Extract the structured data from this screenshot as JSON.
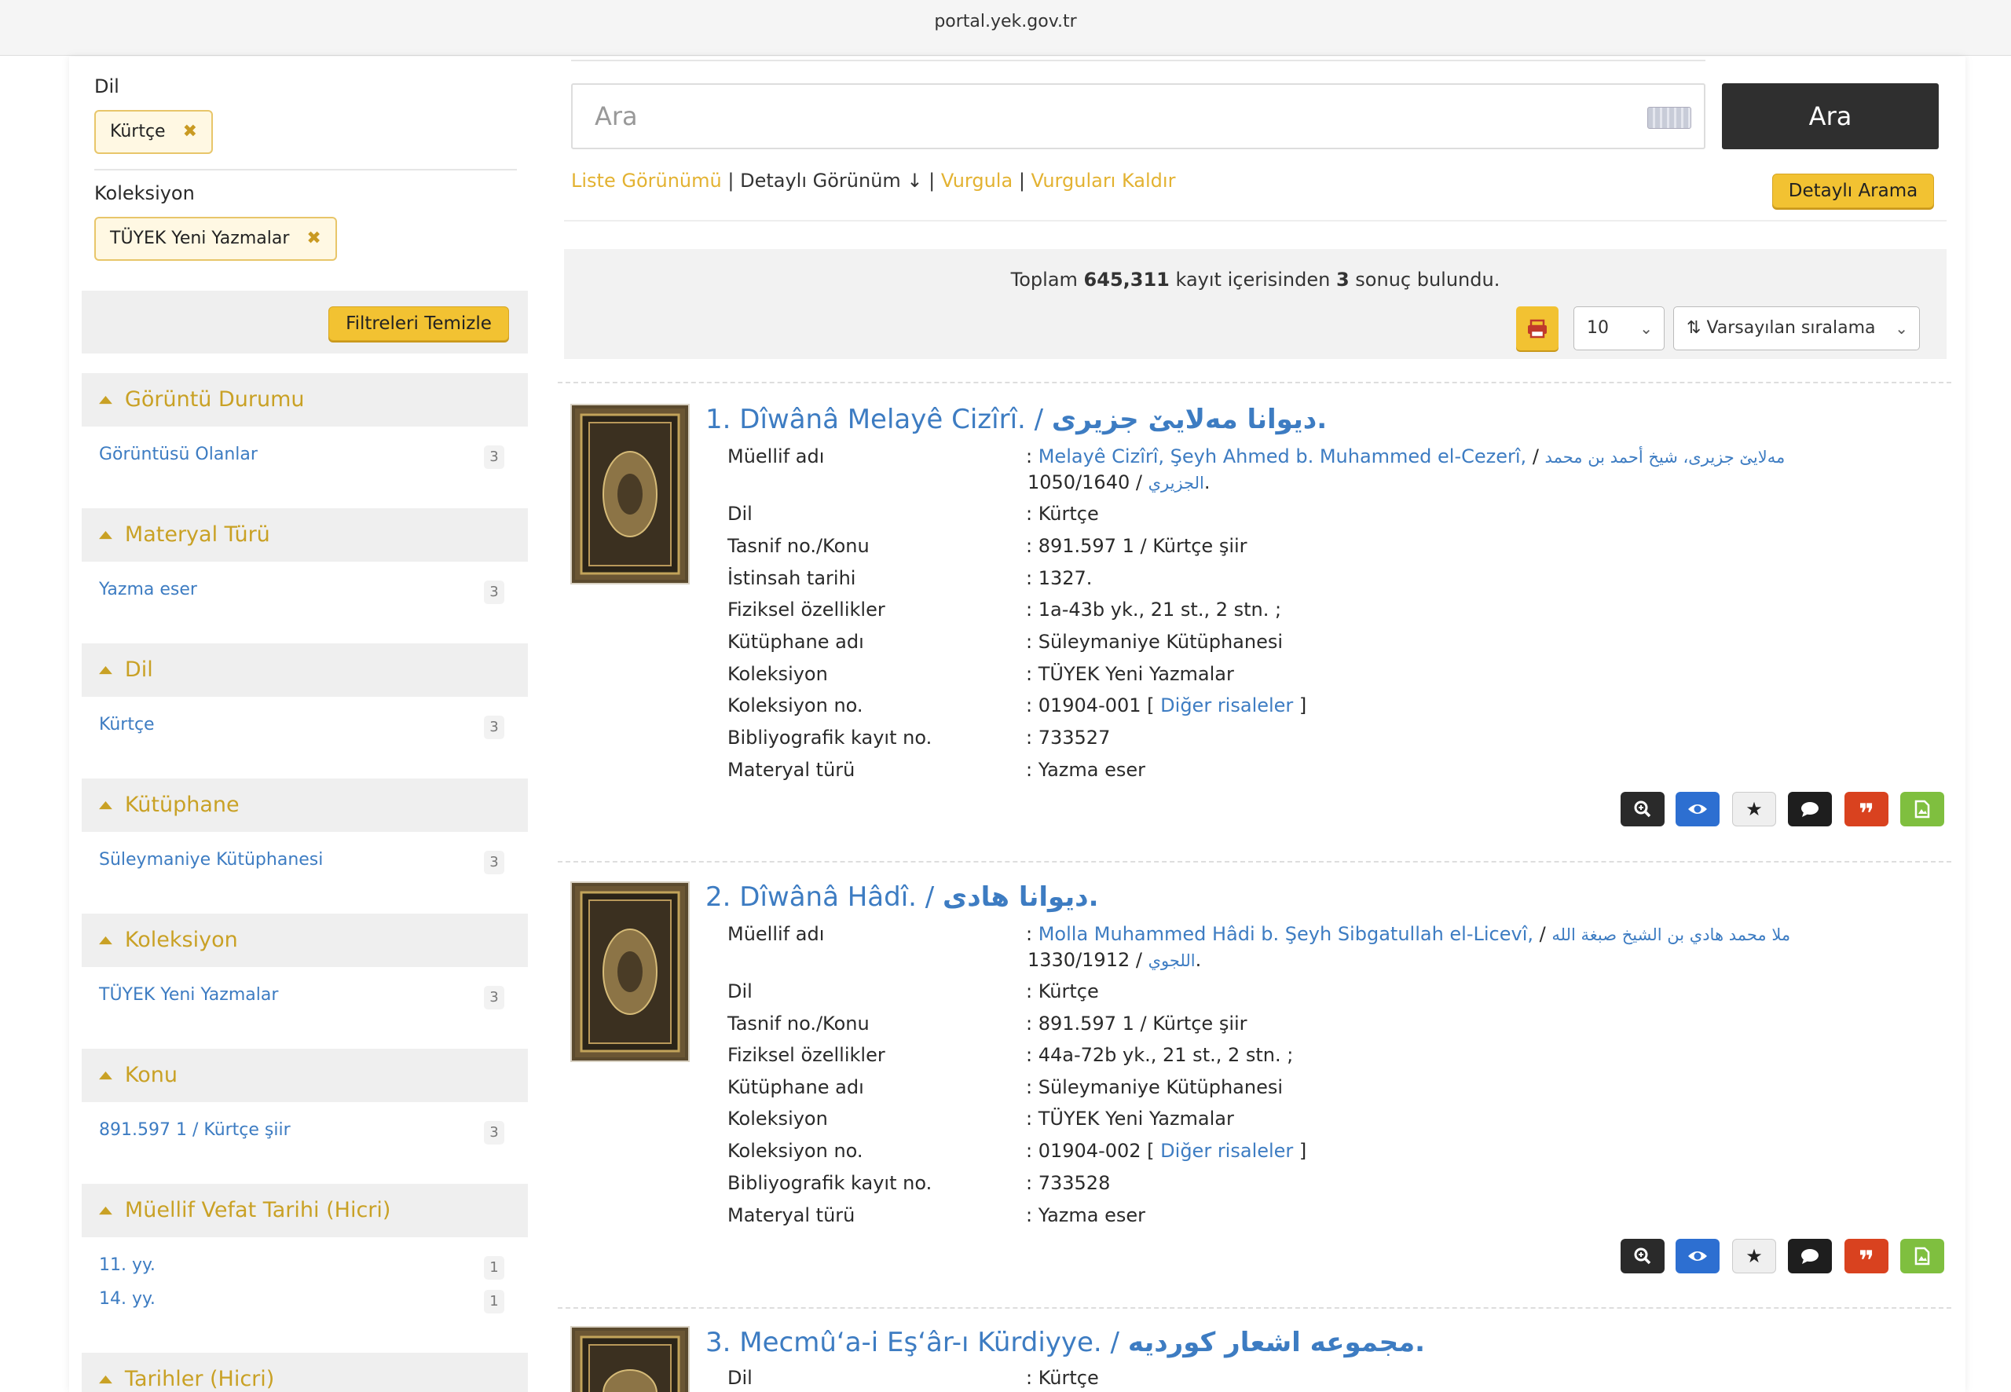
{
  "browser": {
    "url": "portal.yek.gov.tr"
  },
  "sidebar": {
    "applied": [
      {
        "label": "Dil",
        "chip": "Kürtçe"
      },
      {
        "label": "Koleksiyon",
        "chip": "TÜYEK Yeni Yazmalar"
      }
    ],
    "clear_label": "Filtreleri Temizle",
    "facets": [
      {
        "title": "Görüntü Durumu",
        "items": [
          {
            "label": "Görüntüsü Olanlar",
            "count": "3"
          }
        ]
      },
      {
        "title": "Materyal Türü",
        "items": [
          {
            "label": "Yazma eser",
            "count": "3"
          }
        ]
      },
      {
        "title": "Dil",
        "items": [
          {
            "label": "Kürtçe",
            "count": "3"
          }
        ]
      },
      {
        "title": "Kütüphane",
        "items": [
          {
            "label": "Süleymaniye Kütüphanesi",
            "count": "3"
          }
        ]
      },
      {
        "title": "Koleksiyon",
        "items": [
          {
            "label": "TÜYEK Yeni Yazmalar",
            "count": "3"
          }
        ]
      },
      {
        "title": "Konu",
        "items": [
          {
            "label": "891.597 1 / Kürtçe şiir",
            "count": "3"
          }
        ]
      },
      {
        "title": "Müellif Vefat Tarihi (Hicri)",
        "items": [
          {
            "label": "11. yy.",
            "count": "1"
          },
          {
            "label": "14. yy.",
            "count": "1"
          }
        ]
      },
      {
        "title": "Tarihler (Hicri)",
        "items": []
      }
    ]
  },
  "search": {
    "placeholder": "Ara",
    "button": "Ara",
    "advanced": "Detaylı Arama"
  },
  "views": {
    "list": "Liste Görünümü",
    "sep": "|",
    "detailed": "Detaylı Görünüm ↓",
    "highlight": "Vurgula",
    "clear_highlight": "Vurguları Kaldır"
  },
  "results_bar": {
    "prefix": "Toplam ",
    "total": "645,311",
    "middle": " kayıt içerisinden ",
    "found": "3",
    "suffix": " sonuç bulundu.",
    "page_size": "10",
    "sort": "Varsayılan sıralama"
  },
  "results": [
    {
      "num": "1.",
      "title": "Dîwânâ Melayê Cizîrî. /",
      "title_ar": "ديوانا مەلايێ جزيرى.",
      "author": {
        "key": "Müellif adı",
        "link": "Melayê Cizîrî, Şeyh Ahmed b. Muhammed el-Cezerî,",
        "sep": " /",
        "ar": "مەلايێ جزيرى، شيخ أحمد بن محمد",
        "ar2": "الجزيري",
        "dates": " / 1050/1640."
      },
      "fields": [
        {
          "key": "Dil",
          "value": "Kürtçe"
        },
        {
          "key": "Tasnif no./Konu",
          "value": "891.597 1 / Kürtçe şiir"
        },
        {
          "key": "İstinsah tarihi",
          "value": "1327."
        },
        {
          "key": "Fiziksel özellikler",
          "value": "1a-43b yk., 21 st., 2 stn. ;"
        },
        {
          "key": "Kütüphane adı",
          "value": "Süleymaniye Kütüphanesi"
        },
        {
          "key": "Koleksiyon",
          "value": "TÜYEK Yeni Yazmalar"
        },
        {
          "key": "Koleksiyon no.",
          "value": "01904-001 [",
          "link": "Diğer risaleler",
          "after": " ]"
        },
        {
          "key": "Bibliyografik kayıt no.",
          "value": "733527"
        },
        {
          "key": "Materyal türü",
          "value": "Yazma eser"
        }
      ]
    },
    {
      "num": "2.",
      "title": "Dîwânâ Hâdî. /",
      "title_ar": "ديوانا هادى.",
      "author": {
        "key": "Müellif adı",
        "link": "Molla Muhammed Hâdi b. Şeyh Sibgatullah el-Licevî,",
        "sep": " /",
        "ar": "ملا محمد هادي بن الشيخ صبغة الله",
        "ar2": "اللجوي",
        "dates": " / 1330/1912."
      },
      "fields": [
        {
          "key": "Dil",
          "value": "Kürtçe"
        },
        {
          "key": "Tasnif no./Konu",
          "value": "891.597 1 / Kürtçe şiir"
        },
        {
          "key": "Fiziksel özellikler",
          "value": "44a-72b yk., 21 st., 2 stn. ;"
        },
        {
          "key": "Kütüphane adı",
          "value": "Süleymaniye Kütüphanesi"
        },
        {
          "key": "Koleksiyon",
          "value": "TÜYEK Yeni Yazmalar"
        },
        {
          "key": "Koleksiyon no.",
          "value": "01904-002 [",
          "link": "Diğer risaleler",
          "after": " ]"
        },
        {
          "key": "Bibliyografik kayıt no.",
          "value": "733528"
        },
        {
          "key": "Materyal türü",
          "value": "Yazma eser"
        }
      ]
    },
    {
      "num": "3.",
      "title": "Mecmû‘a-i Eş‘âr-ı Kürdiyye. /",
      "title_ar": "مجموعه اشعار كورديه.",
      "fields": [
        {
          "key": "Dil",
          "value": "Kürtçe"
        }
      ]
    }
  ],
  "icons": {
    "colors": {
      "accent": "#f2c232",
      "link": "#3d7cc2",
      "dark": "#2f2f2f",
      "blue": "#2d6fd1",
      "red": "#d9421f",
      "green": "#7fbf3f"
    }
  }
}
